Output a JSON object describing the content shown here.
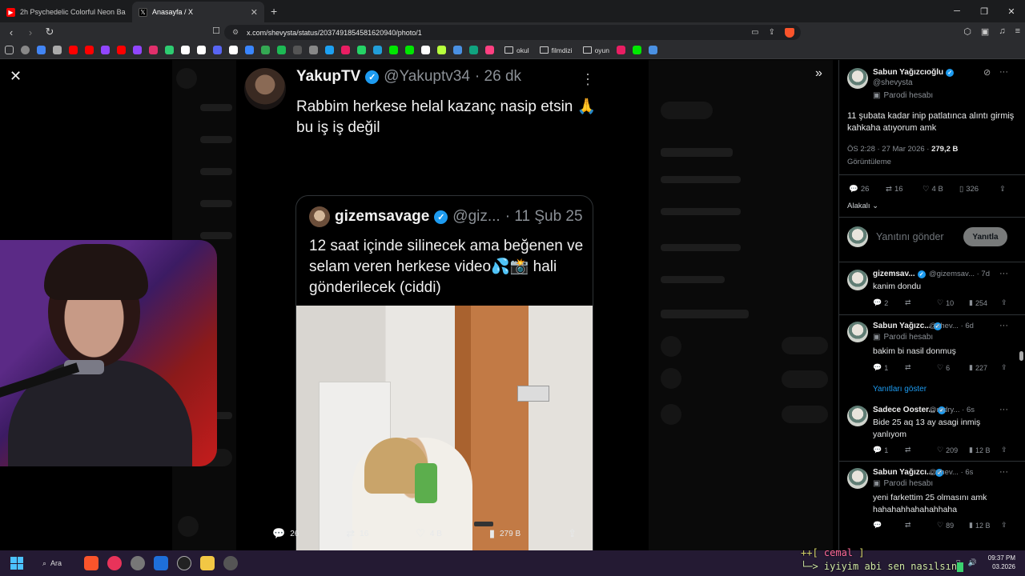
{
  "browser": {
    "tabs": [
      {
        "title": "2h Psychedelic Colorful Neon Backgr",
        "icon": "youtube-icon",
        "color": "#ff0000"
      },
      {
        "title": "Anasayfa / X",
        "icon": "x-logo-icon",
        "color": "#000000"
      }
    ],
    "url": "x.com/shevysta/status/2037491854581620940/photo/1",
    "bookmark_folders": [
      "okul",
      "filmdizi",
      "oyun"
    ],
    "bookmark_icon_colors": [
      "#888",
      "#4285f4",
      "#aaa",
      "#ff0000",
      "#ff0000",
      "#9146ff",
      "#ff0000",
      "#9146ff",
      "#e1306c",
      "#2ecc71",
      "#ffffff",
      "#ffffff",
      "#5865f2",
      "#ffffff",
      "#3a86ff",
      "#34a853",
      "#1db954",
      "#555",
      "#888",
      "#1da1f2",
      "#e91e63",
      "#25d366",
      "#229ed9",
      "#00e701",
      "#00e701",
      "#ffffff",
      "#b7ff3c",
      "#4a90e2",
      "#10a37f",
      "#ff4081"
    ]
  },
  "tweet": {
    "author_name": "YakupTV",
    "handle": "@Yakuptv34",
    "time": "· 26 dk",
    "text": "Rabbim herkese helal kazanç nasip etsin 🙏 bu iş iş değil",
    "quote": {
      "author_name": "gizemsavage",
      "handle": "@giz...",
      "time": "· 11 Şub 25",
      "text": "12 saat içinde silinecek ama beğenen ve selam veren herkese video💦📸 hali gönderilecek (ciddi)"
    },
    "stats": {
      "replies": "26",
      "retweets": "16",
      "likes": "4 B",
      "views": "279 B"
    }
  },
  "sidebar": {
    "main": {
      "name": "Sabun Yağızcıoğlu",
      "handle": "@shevysta",
      "parody": "Parodi hesabı",
      "text": "11 şubata kadar inip patlatınca alıntı girmiş kahkaha atıyorum amk",
      "timestamp": "ÖS 2:28 · 27 Mar 2026 ·",
      "views_count": "279,2 B",
      "views_label": "Görüntüleme",
      "replies": "26",
      "retweets": "16",
      "likes": "4 B",
      "bookmarks": "326",
      "related": "Alakalı"
    },
    "reply_placeholder": "Yanıtını gönder",
    "reply_button": "Yanıtla",
    "show_replies": "Yanıtları göster",
    "replies": [
      {
        "name": "gizemsav...",
        "handle": "@gizemsav...",
        "time": "· 7d",
        "parody": "",
        "text": "kanim dondu",
        "replies": "2",
        "retweets": "",
        "likes": "10",
        "views": "254"
      },
      {
        "name": "Sabun Yağızc...",
        "handle": "@shev...",
        "time": "· 6d",
        "parody": "Parodi hesabı",
        "text": "bakim bi nasil donmuş",
        "replies": "1",
        "retweets": "",
        "likes": "6",
        "views": "227"
      },
      {
        "name": "Sadece Ooster...",
        "handle": "@rodry...",
        "time": "· 6s",
        "parody": "",
        "text": "Bide 25 aq 13 ay asagi inmiş yanlıyom",
        "replies": "1",
        "retweets": "",
        "likes": "209",
        "views": "12 B"
      },
      {
        "name": "Sabun Yağızcı...",
        "handle": "@shev...",
        "time": "· 6s",
        "parody": "Parodi hesabı",
        "text": "yeni farkettim 25 olmasını amk hahahahhahahahhaha",
        "replies": "",
        "retweets": "",
        "likes": "89",
        "views": "12 B"
      }
    ]
  },
  "overlay_chat": {
    "line1_prefix": "++[ ",
    "line1_user": "cemal",
    "line1_suffix": " ]",
    "line2_prefix": "└─> ",
    "line2_text": "iyiyim abi sen nasılsın"
  },
  "taskbar": {
    "search": "Ara",
    "time": "09:37 PM",
    "date": "03.2026"
  }
}
